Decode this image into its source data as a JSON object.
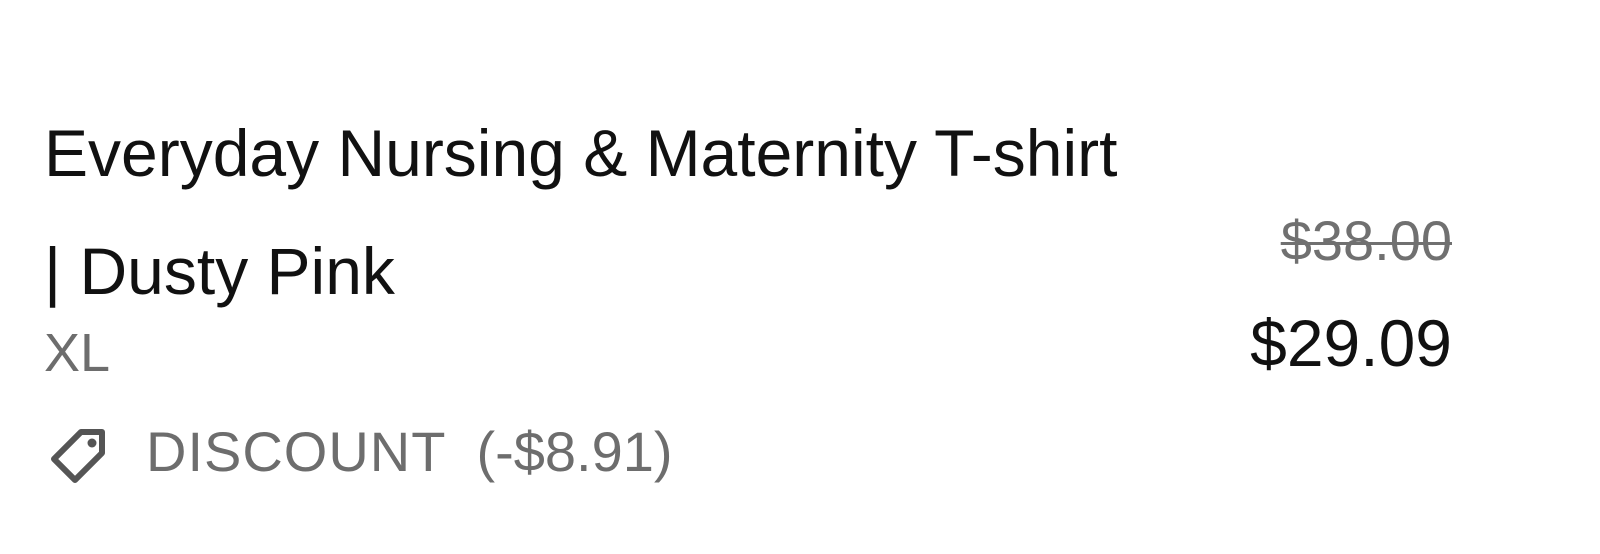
{
  "line_item": {
    "title": "Everyday Nursing & Maternity T-shirt | Dusty Pink",
    "variant": "XL",
    "discount": {
      "label": "DISCOUNT",
      "amount": "(-$8.91)",
      "icon": "tag-icon"
    },
    "price": {
      "original": "$38.00",
      "sale": "$29.09"
    }
  },
  "colors": {
    "primary_text": "#111111",
    "secondary_text": "#6d6d6d",
    "background": "#ffffff"
  }
}
